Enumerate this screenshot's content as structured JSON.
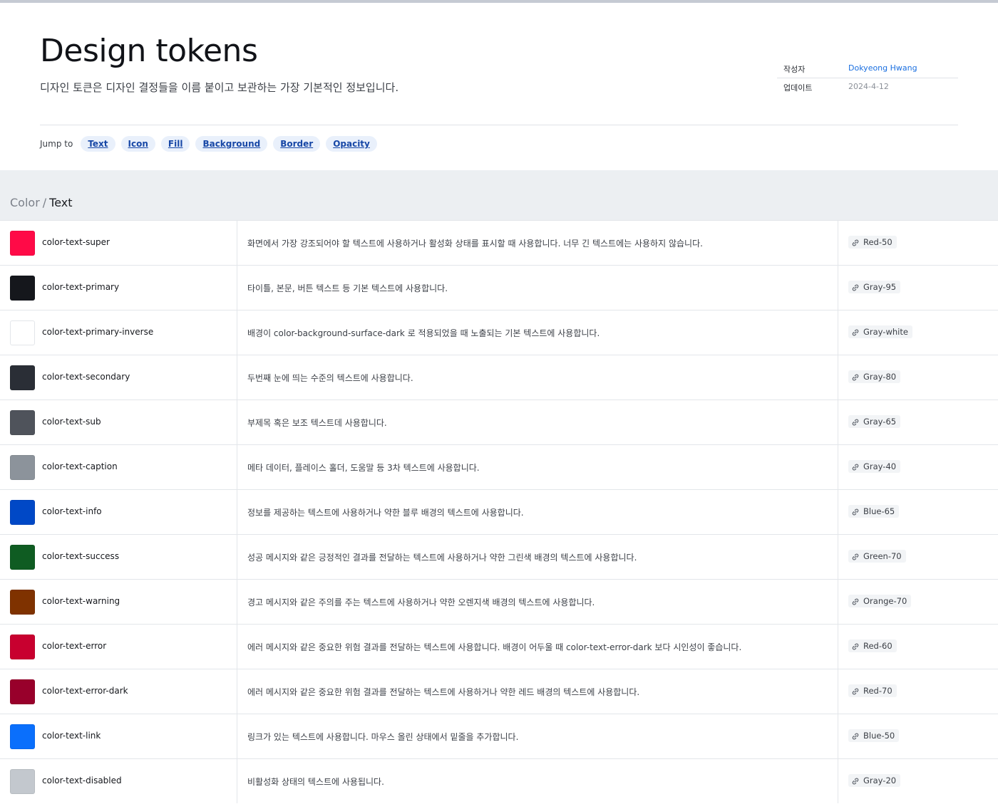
{
  "header": {
    "title": "Design tokens",
    "description": "디자인 토큰은 디자인 결정들을 이름 붙이고 보관하는 가장 기본적인 정보입니다."
  },
  "meta": {
    "author_label": "작성자",
    "author_value": "Dokyeong Hwang",
    "updated_label": "업데이트",
    "updated_value": "2024-4-12"
  },
  "jump": {
    "label": "Jump to",
    "links": [
      "Text",
      "Icon",
      "Fill",
      "Background",
      "Border",
      "Opacity"
    ]
  },
  "section": {
    "parent": "Color",
    "separator": "/",
    "current": "Text"
  },
  "tokens": [
    {
      "name": "color-text-super",
      "color": "#ff0a47",
      "desc": "화면에서 가장 강조되어야 할 텍스트에 사용하거나 활성화 상태를 표시할 때 사용합니다. 너무 긴 텍스트에는 사용하지 않습니다.",
      "ref": "Red-50"
    },
    {
      "name": "color-text-primary",
      "color": "#15171c",
      "desc": "타이틀, 본문, 버튼 텍스트 등 기본 텍스트에 사용합니다.",
      "ref": "Gray-95"
    },
    {
      "name": "color-text-primary-inverse",
      "color": "#ffffff",
      "desc": "배경이 color-background-surface-dark 로 적용되었을 때 노출되는 기본 텍스트에 사용합니다.",
      "ref": "Gray-white"
    },
    {
      "name": "color-text-secondary",
      "color": "#2a2e36",
      "desc": "두번째 눈에 띄는 수준의 텍스트에 사용합니다.",
      "ref": "Gray-80"
    },
    {
      "name": "color-text-sub",
      "color": "#4f535b",
      "desc": "부제목 혹은 보조 텍스트데 사용합니다.",
      "ref": "Gray-65"
    },
    {
      "name": "color-text-caption",
      "color": "#8c939b",
      "desc": "메타 데이터, 플레이스 홀더, 도움말 등 3차 텍스트에 사용합니다.",
      "ref": "Gray-40"
    },
    {
      "name": "color-text-info",
      "color": "#0048c6",
      "desc": "정보를 제공하는 텍스트에 사용하거나 약한 블루 배경의 텍스트에 사용합니다.",
      "ref": "Blue-65"
    },
    {
      "name": "color-text-success",
      "color": "#0f5c22",
      "desc": "성공 메시지와 같은 긍정적인 결과를 전달하는 텍스트에 사용하거나 약한 그린색 배경의 텍스트에 사용합니다.",
      "ref": "Green-70"
    },
    {
      "name": "color-text-warning",
      "color": "#7f3200",
      "desc": "경고 메시지와 같은 주의를 주는 텍스트에 사용하거나 약한 오렌지색 배경의 텍스트에 사용합니다.",
      "ref": "Orange-70"
    },
    {
      "name": "color-text-error",
      "color": "#c8002f",
      "desc": "에러 메시지와 같은 중요한 위험 결과를 전달하는 텍스트에 사용합니다. 배경이 어두울 때 color-text-error-dark 보다 시인성이 좋습니다.",
      "ref": "Red-60"
    },
    {
      "name": "color-text-error-dark",
      "color": "#98002b",
      "desc": "에러 메시지와 같은 중요한 위험 결과를 전달하는 텍스트에 사용하거나 약한 레드 배경의 텍스트에 사용합니다.",
      "ref": "Red-70"
    },
    {
      "name": "color-text-link",
      "color": "#0a6ffc",
      "desc": "링크가 있는 텍스트에 사용합니다. 마우스 올린 상태에서 밑줄을 추가합니다.",
      "ref": "Blue-50"
    },
    {
      "name": "color-text-disabled",
      "color": "#c3c8ce",
      "desc": "비활성화 상태의 텍스트에 사용됩니다.",
      "ref": "Gray-20"
    }
  ]
}
